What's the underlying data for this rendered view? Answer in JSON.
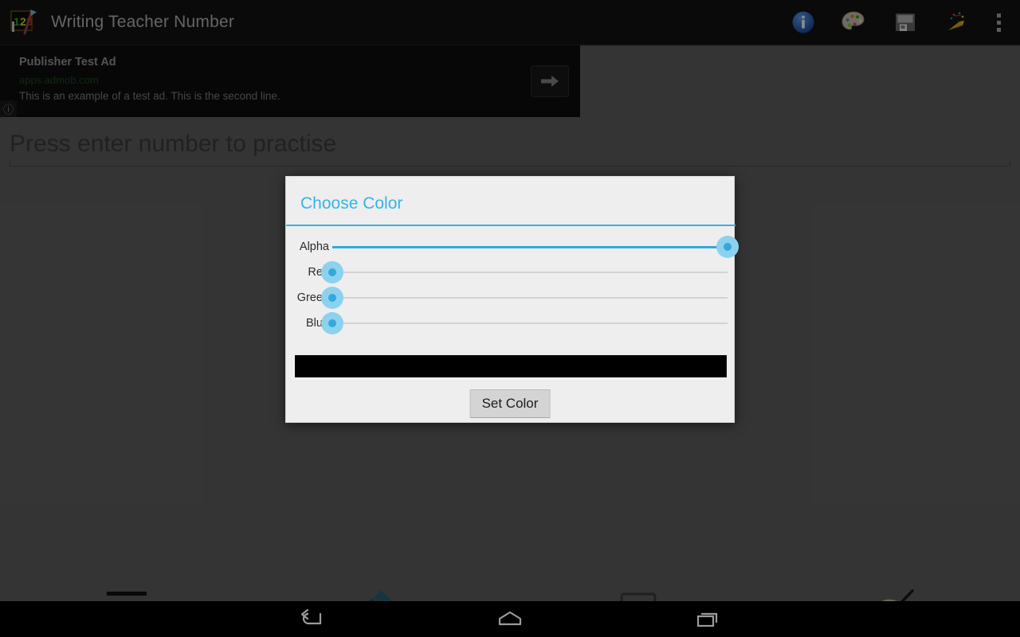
{
  "window": {
    "title": "Writing Teacher Number",
    "app_icon": "chalkboard-123-pencil-icon"
  },
  "actionbar": {
    "items": [
      {
        "name": "info-icon",
        "label": "Info"
      },
      {
        "name": "palette-icon",
        "label": "Palette"
      },
      {
        "name": "save-icon",
        "label": "Save"
      },
      {
        "name": "confetti-icon",
        "label": "Celebrate"
      },
      {
        "name": "overflow-icon",
        "label": "More options"
      }
    ]
  },
  "ad": {
    "headline": "Publisher Test Ad",
    "url": "apps.admob.com",
    "body": "This is an example of a test ad. This is the second line.",
    "cta_icon": "arrow-right-icon",
    "info_badge": "ⓘ",
    "url_color": "#1f4d1f"
  },
  "input": {
    "value": "",
    "placeholder": "Press enter number to practise"
  },
  "tools": [
    {
      "name": "line-thickness-icon",
      "label": "Line thickness"
    },
    {
      "name": "eraser-icon",
      "label": "Eraser"
    },
    {
      "name": "shape-rectangle-icon",
      "label": "Shape"
    },
    {
      "name": "color-palette-icon",
      "label": "Color palette"
    }
  ],
  "dialog": {
    "title": "Choose Color",
    "accent_color": "#33b5e5",
    "sliders": [
      {
        "label": "Alpha",
        "value": 100,
        "min": 0,
        "max": 100
      },
      {
        "label": "Red",
        "value": 0,
        "min": 0,
        "max": 100
      },
      {
        "label": "Green",
        "value": 0,
        "min": 0,
        "max": 100
      },
      {
        "label": "Blue",
        "value": 0,
        "min": 0,
        "max": 100
      }
    ],
    "preview_color": "#000000",
    "button_label": "Set Color"
  },
  "navbar": {
    "buttons": [
      {
        "name": "back-icon",
        "label": "Back"
      },
      {
        "name": "home-icon",
        "label": "Home"
      },
      {
        "name": "recents-icon",
        "label": "Recents"
      }
    ]
  }
}
